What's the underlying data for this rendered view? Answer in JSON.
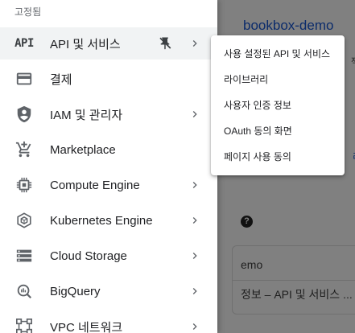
{
  "background_page": {
    "project_title": "bookbox-demo",
    "right_fragment": "젝",
    "link_fragment": "리",
    "help_icon": "help-circle-icon",
    "card": {
      "title": "emo",
      "row_text": "정보 – API 및 서비스 ..."
    }
  },
  "nav": {
    "pinned_label": "고정됨",
    "items": [
      {
        "label": "API 및 서비스",
        "icon": "api-text-icon",
        "icon_text": "API",
        "active": true,
        "pinned": true,
        "has_submenu": true
      },
      {
        "label": "결제",
        "icon": "billing-icon",
        "has_submenu": false
      },
      {
        "label": "IAM 및 관리자",
        "icon": "shield-icon",
        "has_submenu": true
      },
      {
        "label": "Marketplace",
        "icon": "cart-icon",
        "has_submenu": false
      },
      {
        "label": "Compute Engine",
        "icon": "chip-icon",
        "has_submenu": true
      },
      {
        "label": "Kubernetes Engine",
        "icon": "hexagon-icon",
        "has_submenu": true
      },
      {
        "label": "Cloud Storage",
        "icon": "storage-icon",
        "has_submenu": true
      },
      {
        "label": "BigQuery",
        "icon": "bigquery-icon",
        "has_submenu": true
      },
      {
        "label": "VPC 네트워크",
        "icon": "network-icon",
        "has_submenu": true
      }
    ]
  },
  "submenu": {
    "items": [
      {
        "label": "사용 설정된 API 및 서비스"
      },
      {
        "label": "라이브러리"
      },
      {
        "label": "사용자 인증 정보"
      },
      {
        "label": "OAuth 동의 화면"
      },
      {
        "label": "페이지 사용 동의"
      }
    ]
  },
  "colors": {
    "active_bg": "#f1f3f4",
    "icon_gray": "#5f6368",
    "text": "#202124",
    "scrim": "#808080",
    "link_dark": "#0b2b6b"
  }
}
